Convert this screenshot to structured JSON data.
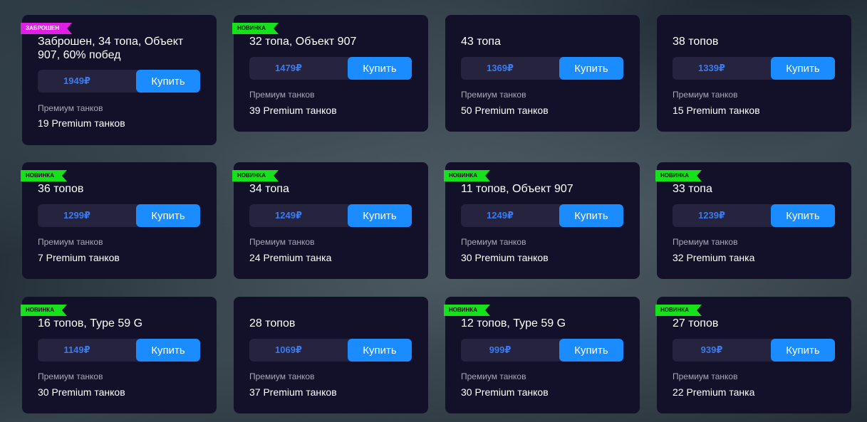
{
  "buy_label": "Купить",
  "cards": [
    {
      "badge": "заброшен",
      "title": "Заброшен, 34 топа, Объект 907, 60% побед",
      "price": "1949₽",
      "label": "Премиум танков",
      "value": "19 Premium танков"
    },
    {
      "badge": "новинка",
      "title": "32 топа, Объект 907",
      "price": "1479₽",
      "label": "Премиум танков",
      "value": "39 Premium танков"
    },
    {
      "badge": "",
      "title": "43 топа",
      "price": "1369₽",
      "label": "Премиум танков",
      "value": "50 Premium танков"
    },
    {
      "badge": "",
      "title": "38 топов",
      "price": "1339₽",
      "label": "Премиум танков",
      "value": "15 Premium танков"
    },
    {
      "badge": "новинка",
      "title": "36 топов",
      "price": "1299₽",
      "label": "Премиум танков",
      "value": "7 Premium танков"
    },
    {
      "badge": "новинка",
      "title": "34 топа",
      "price": "1249₽",
      "label": "Премиум танков",
      "value": "24 Premium танка"
    },
    {
      "badge": "новинка",
      "title": "11 топов, Объект 907",
      "price": "1249₽",
      "label": "Премиум танков",
      "value": "30 Premium танков"
    },
    {
      "badge": "новинка",
      "title": "33 топа",
      "price": "1239₽",
      "label": "Премиум танков",
      "value": "32 Premium танка"
    },
    {
      "badge": "новинка",
      "title": "16 топов, Type 59 G",
      "price": "1149₽",
      "label": "Премиум танков",
      "value": "30 Premium танков"
    },
    {
      "badge": "",
      "title": "28 топов",
      "price": "1069₽",
      "label": "Премиум танков",
      "value": "37 Premium танков"
    },
    {
      "badge": "новинка",
      "title": "12 топов, Type 59 G",
      "price": "999₽",
      "label": "Премиум танков",
      "value": "30 Premium танков"
    },
    {
      "badge": "новинка",
      "title": "27 топов",
      "price": "939₽",
      "label": "Премиум танков",
      "value": "22 Premium танка"
    }
  ]
}
